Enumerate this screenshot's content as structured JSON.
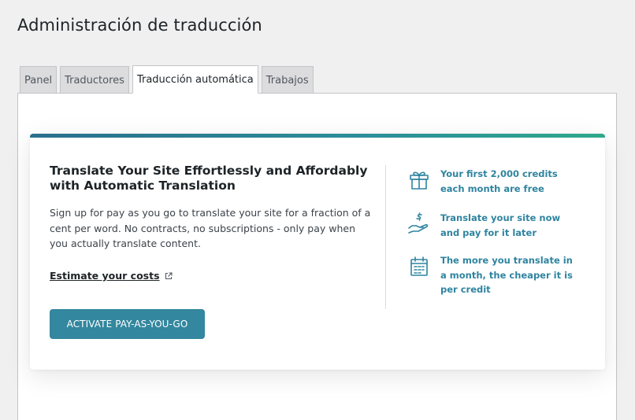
{
  "page": {
    "title": "Administración de traducción"
  },
  "tabs": [
    {
      "label": "Panel",
      "active": false
    },
    {
      "label": "Traductores",
      "active": false
    },
    {
      "label": "Traducción automática",
      "active": true
    },
    {
      "label": "Trabajos",
      "active": false
    }
  ],
  "card": {
    "heading": "Translate Your Site Effortlessly and Affordably with Automatic Translation",
    "description": "Sign up for pay as you go to translate your site for a fraction of a cent per word. No contracts, no subscriptions - only pay when you actually translate content.",
    "estimate_link": "Estimate your costs",
    "activate_button": "ACTIVATE PAY-AS-YOU-GO",
    "features": [
      {
        "icon": "gift-icon",
        "text": "Your first 2,000 credits each month are free"
      },
      {
        "icon": "dollar-hand-icon",
        "text": "Translate your site now and pay for it later"
      },
      {
        "icon": "calendar-icon",
        "text": "The more you translate in a month, the cheaper it is per credit"
      }
    ]
  },
  "colors": {
    "accent": "#33879e",
    "feature_text": "#2f84a0",
    "bar_start": "#2a6f8c",
    "bar_end": "#2fa88b",
    "background": "#f0f0f1"
  }
}
